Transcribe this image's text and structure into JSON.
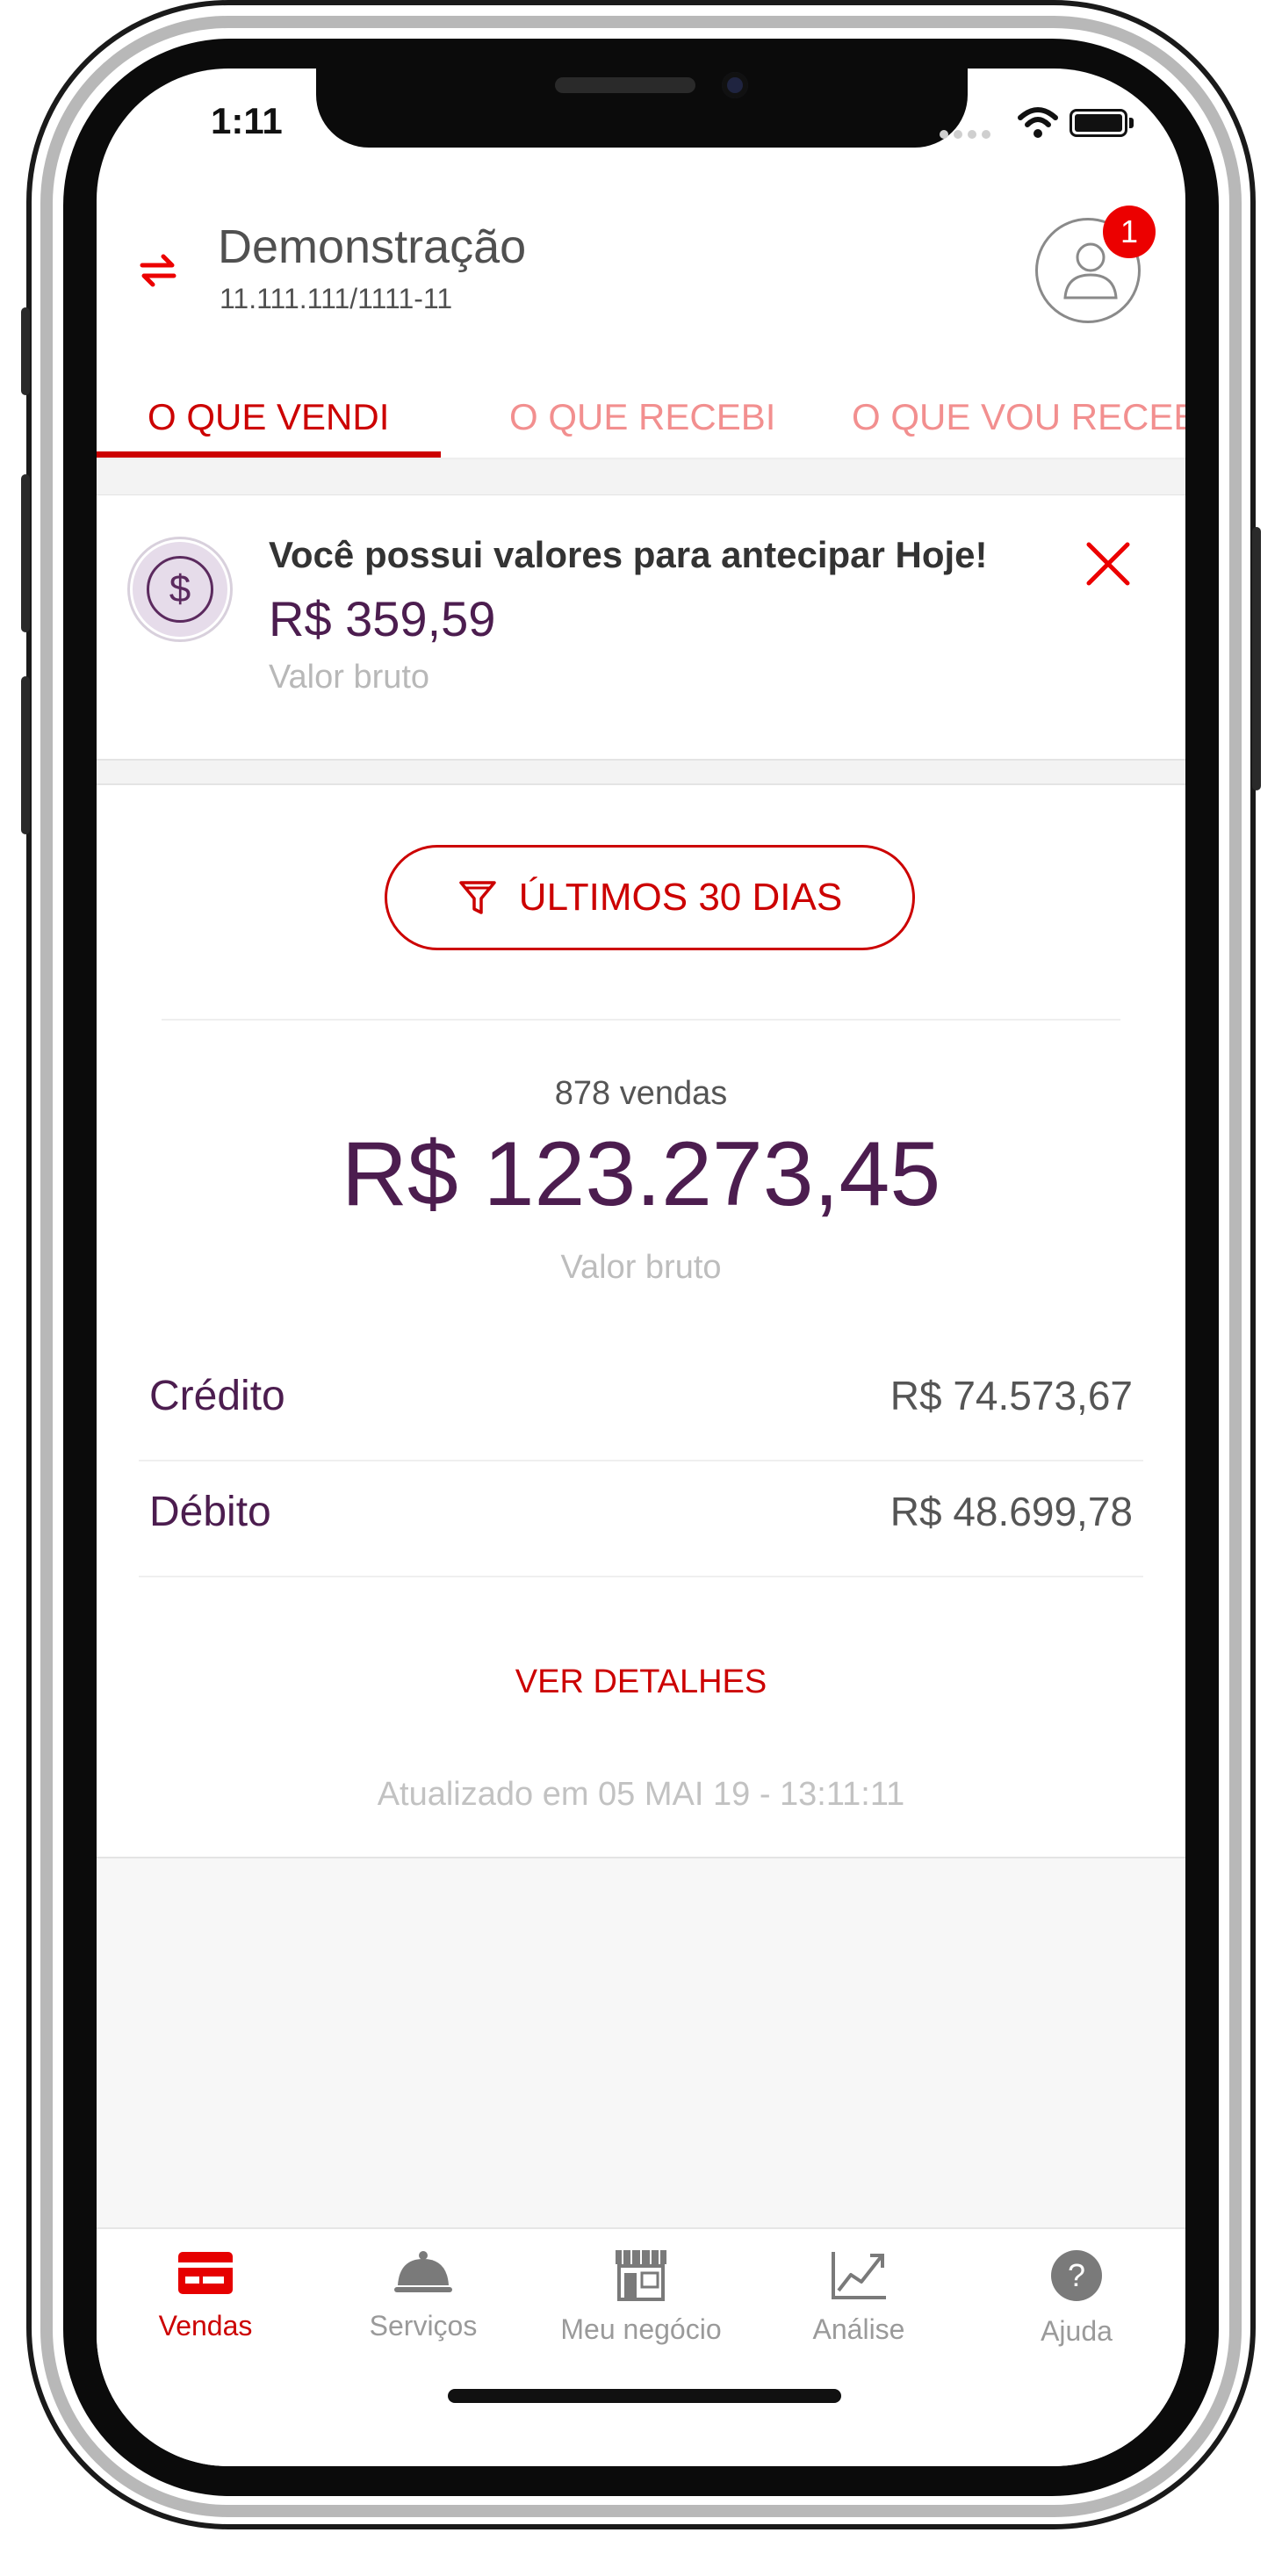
{
  "status_bar": {
    "time": "1:11"
  },
  "header": {
    "company_name": "Demonstração",
    "company_id": "11.111.111/1111-11",
    "notification_count": "1"
  },
  "tabs": [
    {
      "label": "O QUE VENDI",
      "active": true
    },
    {
      "label": "O QUE RECEBI",
      "active": false
    },
    {
      "label": "O QUE VOU RECEBER",
      "active": false
    }
  ],
  "anticipation": {
    "title": "Você possui valores para antecipar Hoje!",
    "value": "R$  359,59",
    "subtitle": "Valor bruto",
    "icon": "dollar-icon"
  },
  "filter": {
    "label": "ÚLTIMOS 30 DIAS",
    "icon": "funnel-icon"
  },
  "summary": {
    "count": "878 vendas",
    "total": "R$  123.273,45",
    "subtitle": "Valor bruto",
    "rows": [
      {
        "label": "Crédito",
        "value": "R$  74.573,67"
      },
      {
        "label": "Débito",
        "value": "R$  48.699,78"
      }
    ],
    "details_link": "VER DETALHES",
    "updated": "Atualizado em 05 MAI 19 - 13:11:11"
  },
  "bottom_nav": [
    {
      "label": "Vendas",
      "icon": "card-icon",
      "active": true
    },
    {
      "label": "Serviços",
      "icon": "cloche-icon",
      "active": false
    },
    {
      "label": "Meu negócio",
      "icon": "store-icon",
      "active": false
    },
    {
      "label": "Análise",
      "icon": "chart-icon",
      "active": false
    },
    {
      "label": "Ajuda",
      "icon": "help-icon",
      "active": false
    }
  ],
  "colors": {
    "accent": "#cc0000",
    "brand_purple": "#4c1d4f",
    "tab_inactive": "#f28f8f",
    "muted": "#9a9a9a"
  }
}
